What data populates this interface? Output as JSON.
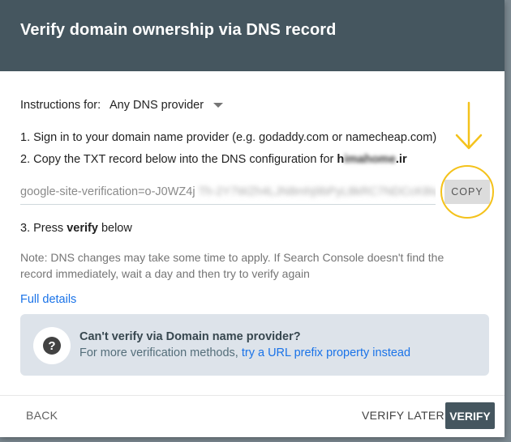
{
  "dialog": {
    "title": "Verify domain ownership via DNS record"
  },
  "instructions": {
    "label": "Instructions for:",
    "selected_provider": "Any DNS provider"
  },
  "steps": {
    "step1": "1. Sign in to your domain name provider (e.g. godaddy.com or namecheap.com)",
    "step2_prefix": "2. Copy the TXT record below into the DNS configuration for ",
    "step2_domain_visible_start": "h",
    "step2_domain_blurred": "imahome",
    "step2_domain_visible_end": ".ir",
    "step3_prefix": "3. Press ",
    "step3_bold": "verify",
    "step3_suffix": " below"
  },
  "txt_record": {
    "visible_value": "google-site-verification=o-J0WZ4j",
    "blurred_value": "Th-2Y7WZh4LJN8mhj9bPyL8kRC7NDCcK8Iu"
  },
  "copy_button": {
    "label": "COPY"
  },
  "note": "Note: DNS changes may take some time to apply. If Search Console doesn't find the record immediately, wait a day and then try to verify again",
  "full_details_link": "Full details",
  "alternative": {
    "icon": "help-icon",
    "title": "Can't verify via Domain name provider?",
    "desc_prefix": "For more verification methods, ",
    "desc_link": "try a URL prefix property instead"
  },
  "footer": {
    "back_label": "BACK",
    "verify_later_label": "VERIFY LATER",
    "verify_label": "VERIFY"
  },
  "colors": {
    "header": "#45565f",
    "link": "#1a73e8",
    "highlight": "#f4c21b"
  }
}
